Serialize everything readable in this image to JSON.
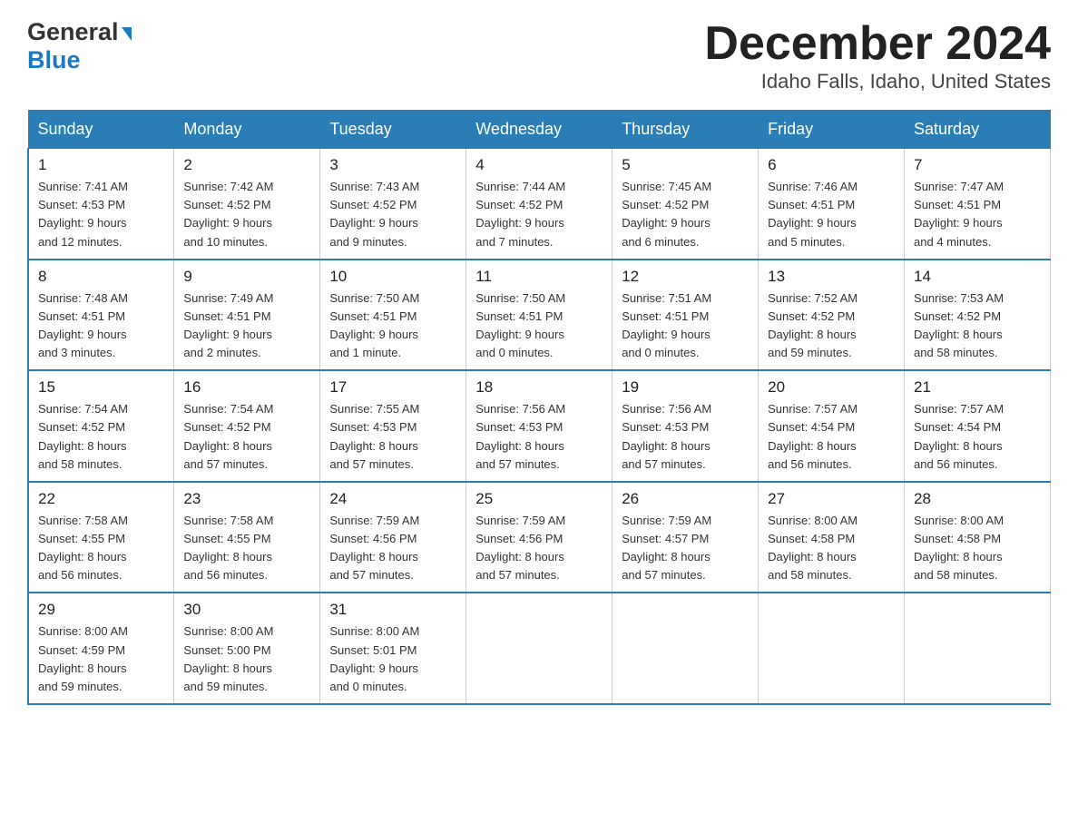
{
  "header": {
    "logo": {
      "general": "General",
      "blue": "Blue"
    },
    "month_title": "December 2024",
    "location": "Idaho Falls, Idaho, United States"
  },
  "weekdays": [
    "Sunday",
    "Monday",
    "Tuesday",
    "Wednesday",
    "Thursday",
    "Friday",
    "Saturday"
  ],
  "weeks": [
    [
      {
        "day": "1",
        "sunrise": "7:41 AM",
        "sunset": "4:53 PM",
        "daylight": "9 hours and 12 minutes."
      },
      {
        "day": "2",
        "sunrise": "7:42 AM",
        "sunset": "4:52 PM",
        "daylight": "9 hours and 10 minutes."
      },
      {
        "day": "3",
        "sunrise": "7:43 AM",
        "sunset": "4:52 PM",
        "daylight": "9 hours and 9 minutes."
      },
      {
        "day": "4",
        "sunrise": "7:44 AM",
        "sunset": "4:52 PM",
        "daylight": "9 hours and 7 minutes."
      },
      {
        "day": "5",
        "sunrise": "7:45 AM",
        "sunset": "4:52 PM",
        "daylight": "9 hours and 6 minutes."
      },
      {
        "day": "6",
        "sunrise": "7:46 AM",
        "sunset": "4:51 PM",
        "daylight": "9 hours and 5 minutes."
      },
      {
        "day": "7",
        "sunrise": "7:47 AM",
        "sunset": "4:51 PM",
        "daylight": "9 hours and 4 minutes."
      }
    ],
    [
      {
        "day": "8",
        "sunrise": "7:48 AM",
        "sunset": "4:51 PM",
        "daylight": "9 hours and 3 minutes."
      },
      {
        "day": "9",
        "sunrise": "7:49 AM",
        "sunset": "4:51 PM",
        "daylight": "9 hours and 2 minutes."
      },
      {
        "day": "10",
        "sunrise": "7:50 AM",
        "sunset": "4:51 PM",
        "daylight": "9 hours and 1 minute."
      },
      {
        "day": "11",
        "sunrise": "7:50 AM",
        "sunset": "4:51 PM",
        "daylight": "9 hours and 0 minutes."
      },
      {
        "day": "12",
        "sunrise": "7:51 AM",
        "sunset": "4:51 PM",
        "daylight": "9 hours and 0 minutes."
      },
      {
        "day": "13",
        "sunrise": "7:52 AM",
        "sunset": "4:52 PM",
        "daylight": "8 hours and 59 minutes."
      },
      {
        "day": "14",
        "sunrise": "7:53 AM",
        "sunset": "4:52 PM",
        "daylight": "8 hours and 58 minutes."
      }
    ],
    [
      {
        "day": "15",
        "sunrise": "7:54 AM",
        "sunset": "4:52 PM",
        "daylight": "8 hours and 58 minutes."
      },
      {
        "day": "16",
        "sunrise": "7:54 AM",
        "sunset": "4:52 PM",
        "daylight": "8 hours and 57 minutes."
      },
      {
        "day": "17",
        "sunrise": "7:55 AM",
        "sunset": "4:53 PM",
        "daylight": "8 hours and 57 minutes."
      },
      {
        "day": "18",
        "sunrise": "7:56 AM",
        "sunset": "4:53 PM",
        "daylight": "8 hours and 57 minutes."
      },
      {
        "day": "19",
        "sunrise": "7:56 AM",
        "sunset": "4:53 PM",
        "daylight": "8 hours and 57 minutes."
      },
      {
        "day": "20",
        "sunrise": "7:57 AM",
        "sunset": "4:54 PM",
        "daylight": "8 hours and 56 minutes."
      },
      {
        "day": "21",
        "sunrise": "7:57 AM",
        "sunset": "4:54 PM",
        "daylight": "8 hours and 56 minutes."
      }
    ],
    [
      {
        "day": "22",
        "sunrise": "7:58 AM",
        "sunset": "4:55 PM",
        "daylight": "8 hours and 56 minutes."
      },
      {
        "day": "23",
        "sunrise": "7:58 AM",
        "sunset": "4:55 PM",
        "daylight": "8 hours and 56 minutes."
      },
      {
        "day": "24",
        "sunrise": "7:59 AM",
        "sunset": "4:56 PM",
        "daylight": "8 hours and 57 minutes."
      },
      {
        "day": "25",
        "sunrise": "7:59 AM",
        "sunset": "4:56 PM",
        "daylight": "8 hours and 57 minutes."
      },
      {
        "day": "26",
        "sunrise": "7:59 AM",
        "sunset": "4:57 PM",
        "daylight": "8 hours and 57 minutes."
      },
      {
        "day": "27",
        "sunrise": "8:00 AM",
        "sunset": "4:58 PM",
        "daylight": "8 hours and 58 minutes."
      },
      {
        "day": "28",
        "sunrise": "8:00 AM",
        "sunset": "4:58 PM",
        "daylight": "8 hours and 58 minutes."
      }
    ],
    [
      {
        "day": "29",
        "sunrise": "8:00 AM",
        "sunset": "4:59 PM",
        "daylight": "8 hours and 59 minutes."
      },
      {
        "day": "30",
        "sunrise": "8:00 AM",
        "sunset": "5:00 PM",
        "daylight": "8 hours and 59 minutes."
      },
      {
        "day": "31",
        "sunrise": "8:00 AM",
        "sunset": "5:01 PM",
        "daylight": "9 hours and 0 minutes."
      },
      null,
      null,
      null,
      null
    ]
  ],
  "labels": {
    "sunrise": "Sunrise:",
    "sunset": "Sunset:",
    "daylight": "Daylight:"
  }
}
